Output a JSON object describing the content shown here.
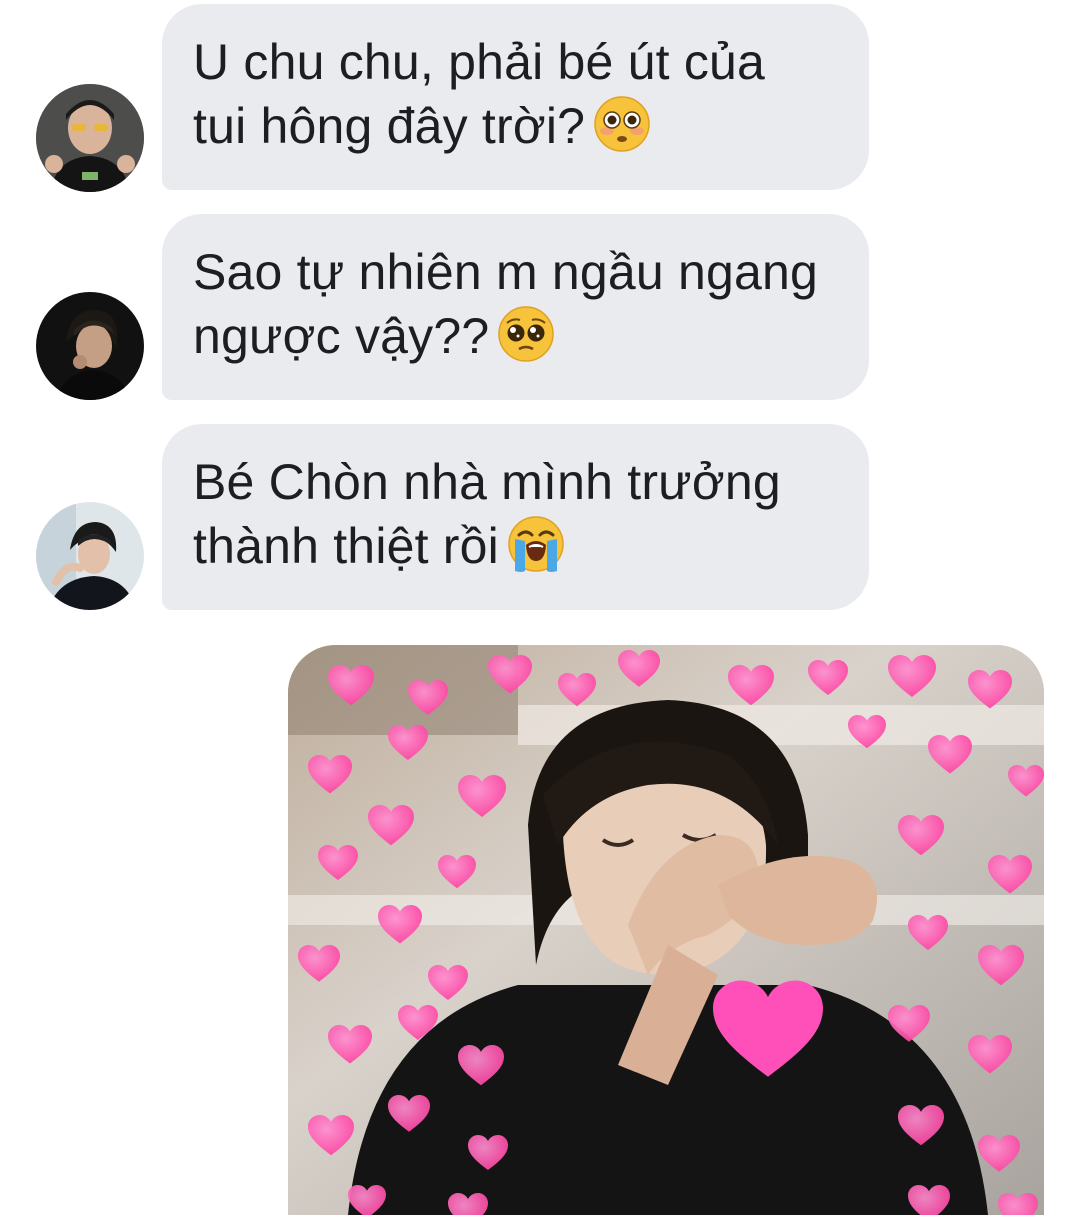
{
  "messages": [
    {
      "lines": [
        "U chu chu, phải bé út của",
        "tui hông đây trời?"
      ],
      "emoji": "flushed-face-emoji",
      "avatar": "contact-avatar-1"
    },
    {
      "lines": [
        "Sao tự nhiên m ngầu ngang",
        "ngược vậy??"
      ],
      "emoji": "pleading-face-emoji",
      "avatar": "contact-avatar-2"
    },
    {
      "lines": [
        "Bé Chòn nhà mình trưởng",
        "thành thiệt rồi"
      ],
      "emoji": "loudly-crying-face-emoji",
      "avatar": "contact-avatar-3"
    }
  ],
  "sent_image": {
    "description_icon": "hearts-photo"
  },
  "colors": {
    "bubble_bg": "#e9ebef",
    "text": "#1c1e21",
    "heart_pink": "#ff4fa3"
  }
}
